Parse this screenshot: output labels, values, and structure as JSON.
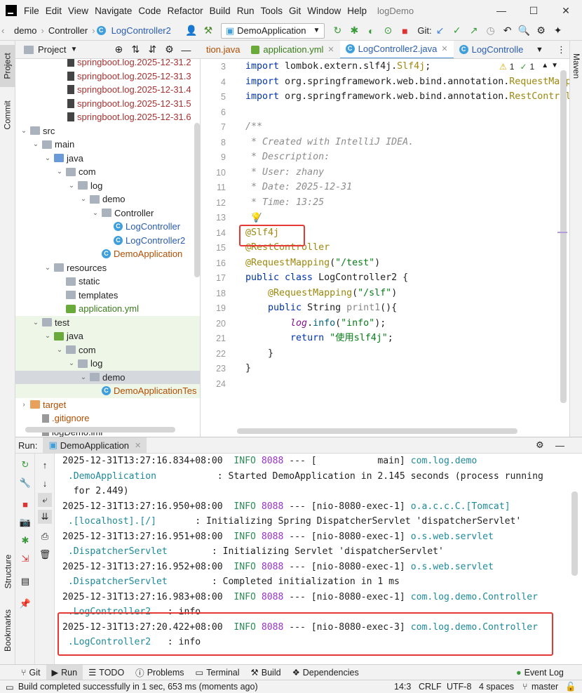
{
  "menubar": {
    "items": [
      "File",
      "Edit",
      "View",
      "Navigate",
      "Code",
      "Refactor",
      "Build",
      "Run",
      "Tools",
      "Git",
      "Window",
      "Help"
    ],
    "title": "logDemo"
  },
  "navbar": {
    "crumbs": [
      "demo",
      "Controller",
      "LogController2"
    ],
    "run_config": "DemoApplication",
    "git_label": "Git:"
  },
  "project": {
    "label": "Project",
    "tree": [
      {
        "label": "springboot.log.2025-12-31.2",
        "kind": "log",
        "color": "#a83232"
      },
      {
        "label": "springboot.log.2025-12-31.3",
        "kind": "log",
        "color": "#a83232"
      },
      {
        "label": "springboot.log.2025-12-31.4",
        "kind": "log",
        "color": "#a83232"
      },
      {
        "label": "springboot.log.2025-12-31.5",
        "kind": "log",
        "color": "#a83232"
      },
      {
        "label": "springboot.log.2025-12-31.6",
        "kind": "log",
        "color": "#a83232"
      },
      {
        "label": "src",
        "kind": "folder",
        "arrow": "v"
      },
      {
        "label": "main",
        "kind": "folder",
        "arrow": "v"
      },
      {
        "label": "java",
        "kind": "folder-b",
        "arrow": "v"
      },
      {
        "label": "com",
        "kind": "folder",
        "arrow": "v"
      },
      {
        "label": "log",
        "kind": "folder",
        "arrow": "v"
      },
      {
        "label": "demo",
        "kind": "folder",
        "arrow": "v"
      },
      {
        "label": "Controller",
        "kind": "folder",
        "arrow": "v"
      },
      {
        "label": "LogController",
        "kind": "class",
        "color": "#2a5db0"
      },
      {
        "label": "LogController2",
        "kind": "class",
        "color": "#2a5db0"
      },
      {
        "label": "DemoApplication",
        "kind": "class",
        "color": "#b34d00"
      },
      {
        "label": "resources",
        "kind": "folder",
        "arrow": "v"
      },
      {
        "label": "static",
        "kind": "folder"
      },
      {
        "label": "templates",
        "kind": "folder"
      },
      {
        "label": "application.yml",
        "kind": "yml",
        "color": "#3a7d1a"
      },
      {
        "label": "test",
        "kind": "folder",
        "arrow": "v"
      },
      {
        "label": "java",
        "kind": "folder-g",
        "arrow": "v"
      },
      {
        "label": "com",
        "kind": "folder",
        "arrow": "v"
      },
      {
        "label": "log",
        "kind": "folder",
        "arrow": "v"
      },
      {
        "label": "demo",
        "kind": "folder",
        "arrow": "v"
      },
      {
        "label": "DemoApplicationTes",
        "kind": "class",
        "color": "#b34d00"
      },
      {
        "label": "target",
        "kind": "folder-o",
        "arrow": ">",
        "color": "#b34d00"
      },
      {
        "label": ".gitignore",
        "kind": "file",
        "color": "#b34d00"
      },
      {
        "label": "logDemo.iml",
        "kind": "file"
      }
    ]
  },
  "tabs": [
    "tion.java",
    "application.yml",
    "LogController2.java",
    "LogControlle"
  ],
  "editor": {
    "line_numbers": [
      "3",
      "4",
      "5",
      "6",
      "7",
      "8",
      "9",
      "10",
      "11",
      "12",
      "13",
      "14",
      "15",
      "16",
      "17",
      "18",
      "19",
      "20",
      "21",
      "22",
      "23",
      "24"
    ],
    "lines": [
      [
        {
          "t": "import ",
          "c": "kw"
        },
        {
          "t": "lombok.extern.slf4j."
        },
        {
          "t": "Slf4j",
          "c": "ann"
        },
        {
          "t": ";"
        }
      ],
      [
        {
          "t": "import ",
          "c": "kw"
        },
        {
          "t": "org.springframework.web.bind.annotation."
        },
        {
          "t": "RequestMappi",
          "c": "ann"
        }
      ],
      [
        {
          "t": "import ",
          "c": "kw"
        },
        {
          "t": "org.springframework.web.bind.annotation."
        },
        {
          "t": "RestControll",
          "c": "ann"
        }
      ],
      [],
      [
        {
          "t": "/**",
          "c": "cmt"
        }
      ],
      [
        {
          "t": " * Created with IntelliJ IDEA.",
          "c": "cmt"
        }
      ],
      [
        {
          "t": " * Description:",
          "c": "cmt"
        }
      ],
      [
        {
          "t": " * User: zhany",
          "c": "cmt"
        }
      ],
      [
        {
          "t": " * Date: 2025-12-31",
          "c": "cmt"
        }
      ],
      [
        {
          "t": " * Time: 13:25",
          "c": "cmt"
        }
      ],
      [
        {
          "t": " */",
          "c": "cmt"
        }
      ],
      [
        {
          "t": "@Slf4j",
          "c": "ann"
        }
      ],
      [
        {
          "t": "@RestController",
          "c": "ann"
        }
      ],
      [
        {
          "t": "@RequestMapping",
          "c": "ann"
        },
        {
          "t": "("
        },
        {
          "t": "\"/test\"",
          "c": "str"
        },
        {
          "t": ")"
        }
      ],
      [
        {
          "t": "public class ",
          "c": "kw"
        },
        {
          "t": "LogController2 {"
        }
      ],
      [
        {
          "t": "    "
        },
        {
          "t": "@RequestMapping",
          "c": "ann"
        },
        {
          "t": "("
        },
        {
          "t": "\"/slf\"",
          "c": "str"
        },
        {
          "t": ")"
        }
      ],
      [
        {
          "t": "    "
        },
        {
          "t": "public ",
          "c": "kw"
        },
        {
          "t": "String "
        },
        {
          "t": "print1",
          "c": "gray"
        },
        {
          "t": "(){"
        }
      ],
      [
        {
          "t": "        "
        },
        {
          "t": "log",
          "c": "fld"
        },
        {
          "t": "."
        },
        {
          "t": "info",
          "c": "mth"
        },
        {
          "t": "("
        },
        {
          "t": "\"info\"",
          "c": "str"
        },
        {
          "t": ");"
        }
      ],
      [
        {
          "t": "        "
        },
        {
          "t": "return ",
          "c": "kw"
        },
        {
          "t": "\"使用slf4j\"",
          "c": "str"
        },
        {
          "t": ";"
        }
      ],
      [
        {
          "t": "    }"
        }
      ],
      [
        {
          "t": "}"
        }
      ],
      []
    ],
    "inspections": {
      "warnings": "1",
      "weak": "1"
    }
  },
  "run": {
    "label": "Run:",
    "tab": "DemoApplication"
  },
  "console": [
    [
      {
        "t": "2025-12-31T13:27:16.834+08:00  "
      },
      {
        "t": "INFO",
        "c": "inf"
      },
      {
        "t": " "
      },
      {
        "t": "8088",
        "c": "pid"
      },
      {
        "t": " --- [           main] "
      },
      {
        "t": "com.log.demo",
        "c": "logger"
      }
    ],
    [
      {
        "t": " .DemoApplication",
        "c": "logger"
      },
      {
        "t": "           : Started DemoApplication in 2.145 seconds (process running"
      }
    ],
    [
      {
        "t": "  for 2.449)"
      }
    ],
    [
      {
        "t": "2025-12-31T13:27:16.950+08:00  "
      },
      {
        "t": "INFO",
        "c": "inf"
      },
      {
        "t": " "
      },
      {
        "t": "8088",
        "c": "pid"
      },
      {
        "t": " --- [nio-8080-exec-1] "
      },
      {
        "t": "o.a.c.c.C.[Tomcat]",
        "c": "logger"
      }
    ],
    [
      {
        "t": " .[localhost].[/]",
        "c": "logger"
      },
      {
        "t": "       : Initializing Spring DispatcherServlet 'dispatcherServlet'"
      }
    ],
    [
      {
        "t": "2025-12-31T13:27:16.951+08:00  "
      },
      {
        "t": "INFO",
        "c": "inf"
      },
      {
        "t": " "
      },
      {
        "t": "8088",
        "c": "pid"
      },
      {
        "t": " --- [nio-8080-exec-1] "
      },
      {
        "t": "o.s.web.servlet",
        "c": "logger"
      }
    ],
    [
      {
        "t": " .DispatcherServlet",
        "c": "logger"
      },
      {
        "t": "        : Initializing Servlet 'dispatcherServlet'"
      }
    ],
    [
      {
        "t": "2025-12-31T13:27:16.952+08:00  "
      },
      {
        "t": "INFO",
        "c": "inf"
      },
      {
        "t": " "
      },
      {
        "t": "8088",
        "c": "pid"
      },
      {
        "t": " --- [nio-8080-exec-1] "
      },
      {
        "t": "o.s.web.servlet",
        "c": "logger"
      }
    ],
    [
      {
        "t": " .DispatcherServlet",
        "c": "logger"
      },
      {
        "t": "        : Completed initialization in 1 ms"
      }
    ],
    [
      {
        "t": "2025-12-31T13:27:16.983+08:00  "
      },
      {
        "t": "INFO",
        "c": "inf"
      },
      {
        "t": " "
      },
      {
        "t": "8088",
        "c": "pid"
      },
      {
        "t": " --- [nio-8080-exec-1] "
      },
      {
        "t": "com.log.demo.Controller",
        "c": "logger"
      }
    ],
    [
      {
        "t": " .LogController2",
        "c": "logger"
      },
      {
        "t": "   : info"
      }
    ],
    [
      {
        "t": "2025-12-31T13:27:20.422+08:00  "
      },
      {
        "t": "INFO",
        "c": "inf"
      },
      {
        "t": " "
      },
      {
        "t": "8088",
        "c": "pid"
      },
      {
        "t": " --- [nio-8080-exec-3] "
      },
      {
        "t": "com.log.demo.Controller",
        "c": "logger"
      }
    ],
    [
      {
        "t": " .LogController2",
        "c": "logger"
      },
      {
        "t": "   : info"
      }
    ]
  ],
  "left_strip": [
    "Project",
    "Commit",
    "Structure",
    "Bookmarks"
  ],
  "right_strip": [
    "Maven"
  ],
  "bottom_tabs": [
    "Git",
    "Run",
    "TODO",
    "Problems",
    "Terminal",
    "Build",
    "Dependencies"
  ],
  "event_log": "Event Log",
  "status": {
    "message": "Build completed successfully in 1 sec, 653 ms (moments ago)",
    "position": "14:3",
    "line_sep": "CRLF",
    "encoding": "UTF-8",
    "indent": "4 spaces",
    "branch": "master"
  },
  "colors": {
    "accent": "#4a8ed8",
    "highlight_box": "#e53935"
  }
}
